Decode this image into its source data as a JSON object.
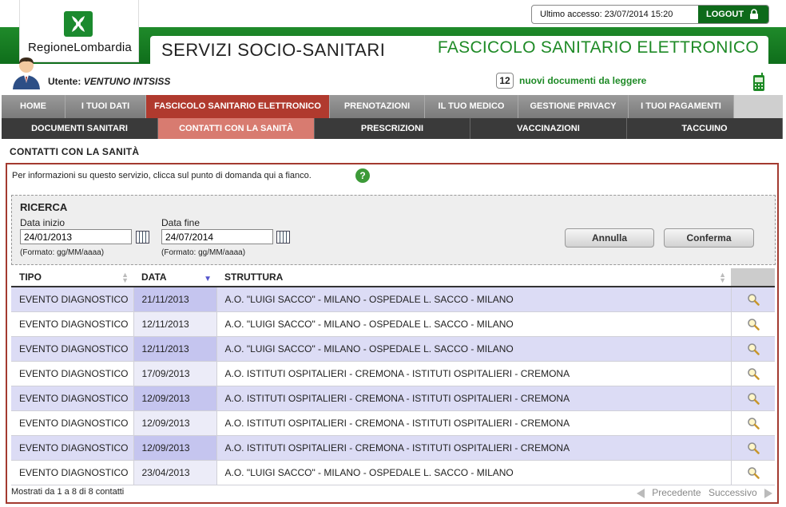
{
  "header": {
    "logo_text": "RegioneLombardia",
    "last_access": "Ultimo accesso: 23/07/2014 15:20",
    "logout_label": "LOGOUT",
    "title_left": "SERVIZI SOCIO-SANITARI",
    "title_right": "FASCICOLO SANITARIO ELETTRONICO"
  },
  "user": {
    "label": "Utente:",
    "name": "VENTUNO INTSISS",
    "notif_count": "12",
    "notif_text": "nuovi documenti da leggere"
  },
  "main_nav": [
    {
      "label": "HOME"
    },
    {
      "label": "I TUOI DATI"
    },
    {
      "label": "FASCICOLO SANITARIO ELETTRONICO"
    },
    {
      "label": "PRENOTAZIONI"
    },
    {
      "label": "IL TUO MEDICO"
    },
    {
      "label": "GESTIONE PRIVACY"
    },
    {
      "label": "I TUOI PAGAMENTI"
    }
  ],
  "sub_nav": [
    {
      "label": "DOCUMENTI SANITARI"
    },
    {
      "label": "CONTATTI CON LA SANITÀ"
    },
    {
      "label": "PRESCRIZIONI"
    },
    {
      "label": "VACCINAZIONI"
    },
    {
      "label": "TACCUINO"
    }
  ],
  "page": {
    "title": "CONTATTI CON LA SANITÀ",
    "info_text": "Per informazioni su questo servizio, clicca sul punto di domanda qui a fianco.",
    "help_glyph": "?"
  },
  "search": {
    "title": "RICERCA",
    "start_label": "Data inizio",
    "start_value": "24/01/2013",
    "end_label": "Data fine",
    "end_value": "24/07/2014",
    "format_hint": "(Formato: gg/MM/aaaa)",
    "cancel_label": "Annulla",
    "confirm_label": "Conferma"
  },
  "table": {
    "columns": [
      "TIPO",
      "DATA",
      "STRUTTURA"
    ],
    "rows": [
      {
        "tipo": "EVENTO DIAGNOSTICO",
        "data": "21/11/2013",
        "struttura": "A.O. \"LUIGI SACCO\" - MILANO - OSPEDALE L. SACCO - MILANO"
      },
      {
        "tipo": "EVENTO DIAGNOSTICO",
        "data": "12/11/2013",
        "struttura": "A.O. \"LUIGI SACCO\" - MILANO - OSPEDALE L. SACCO - MILANO"
      },
      {
        "tipo": "EVENTO DIAGNOSTICO",
        "data": "12/11/2013",
        "struttura": "A.O. \"LUIGI SACCO\" - MILANO - OSPEDALE L. SACCO - MILANO"
      },
      {
        "tipo": "EVENTO DIAGNOSTICO",
        "data": "17/09/2013",
        "struttura": "A.O. ISTITUTI OSPITALIERI - CREMONA - ISTITUTI OSPITALIERI - CREMONA"
      },
      {
        "tipo": "EVENTO DIAGNOSTICO",
        "data": "12/09/2013",
        "struttura": "A.O. ISTITUTI OSPITALIERI - CREMONA - ISTITUTI OSPITALIERI - CREMONA"
      },
      {
        "tipo": "EVENTO DIAGNOSTICO",
        "data": "12/09/2013",
        "struttura": "A.O. ISTITUTI OSPITALIERI - CREMONA - ISTITUTI OSPITALIERI - CREMONA"
      },
      {
        "tipo": "EVENTO DIAGNOSTICO",
        "data": "12/09/2013",
        "struttura": "A.O. ISTITUTI OSPITALIERI - CREMONA - ISTITUTI OSPITALIERI - CREMONA"
      },
      {
        "tipo": "EVENTO DIAGNOSTICO",
        "data": "23/04/2013",
        "struttura": "A.O. \"LUIGI SACCO\" - MILANO - OSPEDALE L. SACCO - MILANO"
      }
    ]
  },
  "footer": {
    "count_text": "Mostrati da 1 a 8 di 8 contatti",
    "prev_label": "Precedente",
    "next_label": "Successivo"
  },
  "colors": {
    "brand_green": "#1e8a26",
    "active_tab": "#b03a2e",
    "active_subtab": "#d87b70",
    "panel_border": "#a33a30"
  }
}
